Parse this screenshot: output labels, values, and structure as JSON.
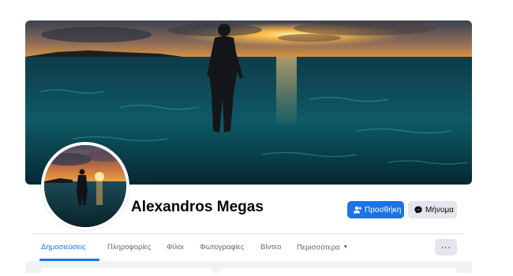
{
  "profile": {
    "name": "Alexandros Megas"
  },
  "actions": {
    "add_label": "Προσθήκη",
    "add_icon": "add-friend-icon",
    "message_label": "Μήνυμα",
    "message_icon": "messenger-icon",
    "more_icon": "more-dots-icon",
    "more_label": "···"
  },
  "tabs": [
    {
      "label": "Δημοσιεύσεις",
      "active": true
    },
    {
      "label": "Πληροφορίες",
      "active": false
    },
    {
      "label": "Φίλοι",
      "active": false
    },
    {
      "label": "Φωτογραφίες",
      "active": false
    },
    {
      "label": "Βίντεο",
      "active": false
    },
    {
      "label": "Περισσότερα",
      "active": false,
      "icon": "caret-down-icon"
    }
  ],
  "colors": {
    "accent": "#1b74e4",
    "secondary_button": "#e4e6eb",
    "muted_text": "#65676b",
    "page_background": "#f0f2f5"
  }
}
